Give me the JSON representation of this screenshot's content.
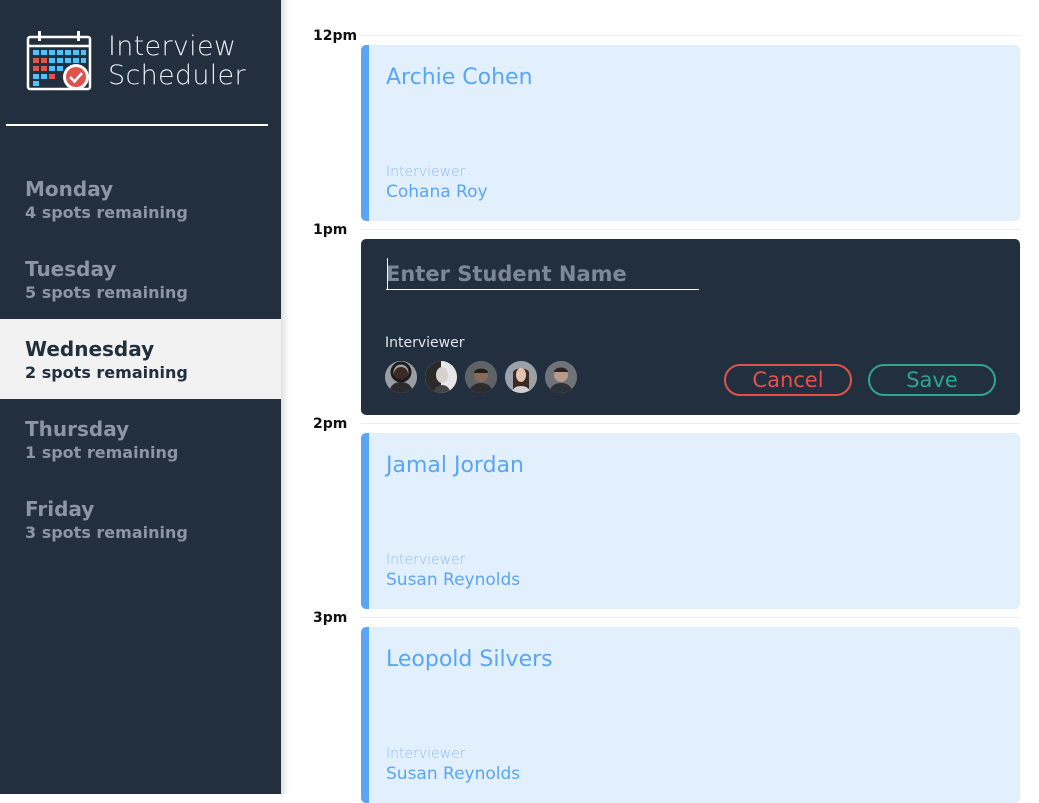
{
  "app": {
    "title_line1": "Interview",
    "title_line2": "Scheduler"
  },
  "days": [
    {
      "name": "Monday",
      "spots": "4 spots remaining",
      "selected": false
    },
    {
      "name": "Tuesday",
      "spots": "5 spots remaining",
      "selected": false
    },
    {
      "name": "Wednesday",
      "spots": "2 spots remaining",
      "selected": true
    },
    {
      "name": "Thursday",
      "spots": "1 spot remaining",
      "selected": false
    },
    {
      "name": "Friday",
      "spots": "3 spots remaining",
      "selected": false
    }
  ],
  "slots": [
    {
      "time": "12pm",
      "student": "Archie Cohen",
      "interviewer_label": "Interviewer",
      "interviewer": "Cohana Roy"
    },
    {
      "time": "1pm",
      "form": {
        "placeholder": "Enter Student Name",
        "value": "",
        "interviewer_label": "Interviewer",
        "cancel_label": "Cancel",
        "save_label": "Save"
      }
    },
    {
      "time": "2pm",
      "student": "Jamal Jordan",
      "interviewer_label": "Interviewer",
      "interviewer": "Susan Reynolds"
    },
    {
      "time": "3pm",
      "student": "Leopold Silvers",
      "interviewer_label": "Interviewer",
      "interviewer": "Susan Reynolds"
    }
  ],
  "colors": {
    "sidebar": "#222f3e",
    "accent_blue": "#5aa5f5",
    "card_bg": "#e2effd",
    "cancel": "#e0524b",
    "save": "#2fa58b"
  },
  "icons": [
    "calendar-check-logo-icon"
  ]
}
